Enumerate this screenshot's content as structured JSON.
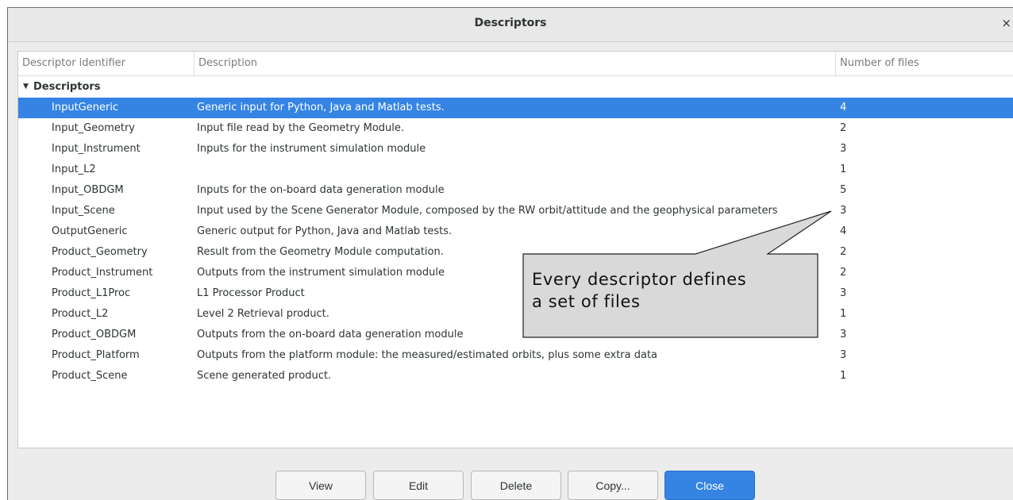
{
  "window": {
    "title": "Descriptors",
    "close_glyph": "×"
  },
  "table": {
    "columns": [
      "Descriptor identifier",
      "Description",
      "Number of files"
    ],
    "group_label": "Descriptors",
    "rows": [
      {
        "id": "InputGeneric",
        "description": "Generic input for Python, Java and Matlab tests.",
        "files": "4",
        "selected": true
      },
      {
        "id": "Input_Geometry",
        "description": "Input file read by the Geometry Module.",
        "files": "2"
      },
      {
        "id": "Input_Instrument",
        "description": "Inputs for the instrument simulation module",
        "files": "3"
      },
      {
        "id": "Input_L2",
        "description": "",
        "files": "1"
      },
      {
        "id": "Input_OBDGM",
        "description": "Inputs for the on-board data generation module",
        "files": "5"
      },
      {
        "id": "Input_Scene",
        "description": "Input used by the Scene Generator Module, composed by the RW orbit/attitude and the geophysical parameters",
        "files": "3"
      },
      {
        "id": "OutputGeneric",
        "description": "Generic output for Python, Java and Matlab tests.",
        "files": "4"
      },
      {
        "id": "Product_Geometry",
        "description": "Result from the Geometry Module computation.",
        "files": "2"
      },
      {
        "id": "Product_Instrument",
        "description": "Outputs from the instrument simulation module",
        "files": "2"
      },
      {
        "id": "Product_L1Proc",
        "description": "L1 Processor Product",
        "files": "3"
      },
      {
        "id": "Product_L2",
        "description": "Level 2 Retrieval product.",
        "files": "1"
      },
      {
        "id": "Product_OBDGM",
        "description": "Outputs from the on-board data generation module",
        "files": "3"
      },
      {
        "id": "Product_Platform",
        "description": "Outputs from the platform module: the measured/estimated orbits, plus some extra data",
        "files": "3"
      },
      {
        "id": "Product_Scene",
        "description": "Scene generated product.",
        "files": "1"
      }
    ]
  },
  "callout": {
    "line1": "Every descriptor defines",
    "line2": "a set of files"
  },
  "buttons": {
    "view": "View",
    "edit": "Edit",
    "delete": "Delete",
    "copy": "Copy...",
    "close": "Close"
  },
  "colors": {
    "selection": "#3584e4",
    "callout_fill": "#d9d9d9"
  }
}
